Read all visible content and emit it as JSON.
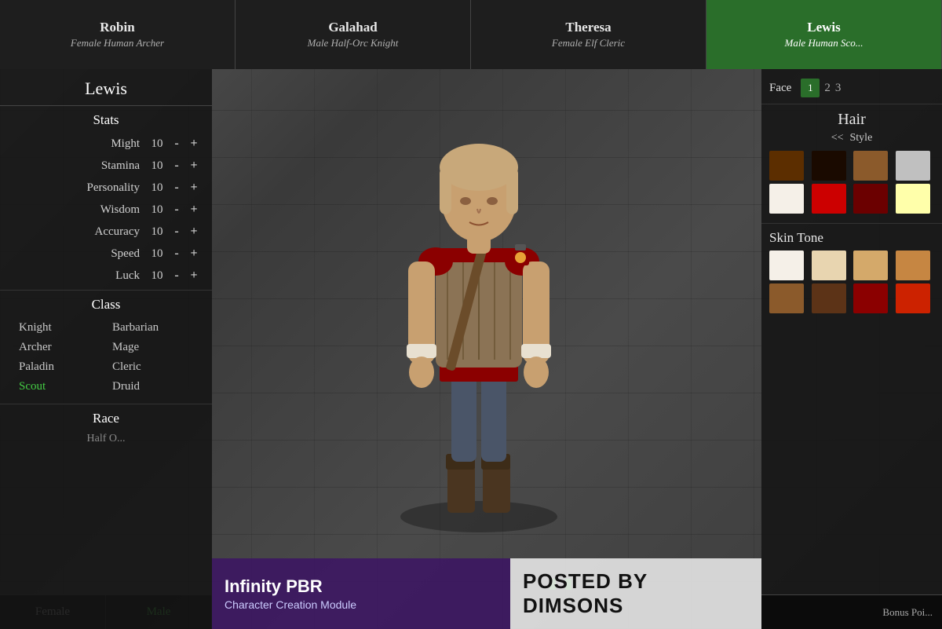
{
  "tabs": [
    {
      "id": "robin",
      "name": "Robin",
      "desc": "Female Human Archer",
      "active": false
    },
    {
      "id": "galahad",
      "name": "Galahad",
      "desc": "Male Half-Orc Knight",
      "active": false
    },
    {
      "id": "theresa",
      "name": "Theresa",
      "desc": "Female Elf Cleric",
      "active": false
    },
    {
      "id": "lewis",
      "name": "Lewis",
      "desc": "Male Human Sco...",
      "active": true
    }
  ],
  "character": {
    "name": "Lewis",
    "stats_header": "Stats",
    "stats": [
      {
        "name": "Might",
        "value": "10"
      },
      {
        "name": "Stamina",
        "value": "10"
      },
      {
        "name": "Personality",
        "value": "10"
      },
      {
        "name": "Wisdom",
        "value": "10"
      },
      {
        "name": "Accuracy",
        "value": "10"
      },
      {
        "name": "Speed",
        "value": "10"
      },
      {
        "name": "Luck",
        "value": "10"
      }
    ],
    "class_header": "Class",
    "classes": [
      {
        "name": "Knight",
        "active": false
      },
      {
        "name": "Barbarian",
        "active": false
      },
      {
        "name": "Archer",
        "active": false
      },
      {
        "name": "Mage",
        "active": false
      },
      {
        "name": "Paladin",
        "active": false
      },
      {
        "name": "Cleric",
        "active": false
      },
      {
        "name": "Scout",
        "active": true
      },
      {
        "name": "Druid",
        "active": false
      }
    ],
    "race_header": "Race",
    "race_partial": "Half O...",
    "gender": {
      "female": "Female",
      "male": "Male",
      "active": "male"
    }
  },
  "appearance": {
    "face_label": "Face",
    "face_selected": "1",
    "face_options": [
      "2",
      "3"
    ],
    "hair_title": "Hair",
    "hair_style_nav_left": "<<",
    "hair_style_label": "Style",
    "hair_colors": [
      "#5c2e00",
      "#1a0a00",
      "#8b5a2b",
      "#c0c0c0",
      "#ffffff",
      "#cc0000",
      "#6b0000",
      "#ffffaa",
      "#ffffff",
      "#dd0000",
      "#8b0000"
    ],
    "skin_title": "Skin Tone",
    "skin_colors": [
      "#f5f0e8",
      "#e8d5b0",
      "#d4a96a",
      "#c68642",
      "#8b5a2b",
      "#5c3317",
      "#8b0000",
      "#cc2200"
    ]
  },
  "overlays": {
    "bottom_left_title": "Infinity PBR",
    "bottom_left_subtitle": "Character Creation Module",
    "bottom_right_text": "POSTED BY DIMSONS"
  },
  "bottom": {
    "bonus_label": "Bonus Poi..."
  }
}
